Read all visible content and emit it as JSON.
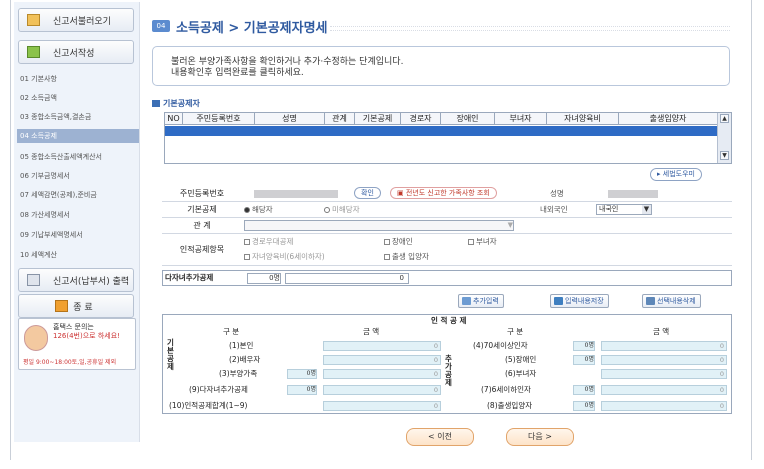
{
  "sidebar": {
    "top_buttons": [
      {
        "label": "신고서불러오기"
      },
      {
        "label": "신고서작성"
      }
    ],
    "menu": [
      {
        "label": "01 기본사항"
      },
      {
        "label": "02 소득금액"
      },
      {
        "label": "03 종합소득금액,결손금"
      },
      {
        "label": "04 소득공제",
        "active": true
      },
      {
        "label": "05 종합소득산출세액계산서"
      },
      {
        "label": "06 기부금명세서"
      },
      {
        "label": "07 세액감면(공제),준비금"
      },
      {
        "label": "08 가산세명세서"
      },
      {
        "label": "09 기납부세액명세서"
      },
      {
        "label": "10 세액계산"
      }
    ],
    "print_button": "신고서(납부서) 출력",
    "exit_button": "종 료",
    "help": {
      "line1": "홈택스 문의는",
      "line2": "126(4번)으로 하세요!",
      "hours": "평일 9:00~18:00토,일,공휴일 제외"
    }
  },
  "page": {
    "badge": "04",
    "title": "소득공제 > 기본공제자명세",
    "info_line1": "불러온 부양가족사항을 확인하거나 추가·수정하는 단계입니다.",
    "info_line2": "내용확인후 입력완료를 클릭하세요."
  },
  "grid": {
    "section_title": "기본공제자",
    "columns": [
      "NO",
      "주민등록번호",
      "성명",
      "관계",
      "기본공제",
      "경로자",
      "장애인",
      "부녀자",
      "자녀양육비",
      "출생입양자"
    ]
  },
  "help_button": "세법도우미",
  "form": {
    "rrn_label": "주민등록번호",
    "confirm_button": "확인",
    "prev_year_button": "전년도 신고한 가족사항 조회",
    "name_label": "성명",
    "basic_label": "기본공제",
    "basic_options": [
      "해당자",
      "미해당자"
    ],
    "nationality_label": "내외국인",
    "nationality_value": "내국인",
    "relation_label": "관 계",
    "personal_label": "인적공제항목",
    "checks_row1": [
      "경로우대공제",
      "장애인",
      "부녀자"
    ],
    "checks_row2": [
      "자녀양육비(6세이하자)",
      "출생 입양자"
    ],
    "multi_label": "다자녀추가공제",
    "multi_count": "0명",
    "multi_amount": "0"
  },
  "actions": {
    "add": "추가입력",
    "save": "입력내용저장",
    "delete": "선택내용삭제"
  },
  "deduct": {
    "title": "인 적 공 제",
    "col_gubun": "구 분",
    "col_amount": "금 액",
    "group_basic": "기본공제",
    "group_extra": "추가공제",
    "left_rows": [
      {
        "label": "(1)본인",
        "count": "",
        "amount": "0"
      },
      {
        "label": "(2)배우자",
        "count": "",
        "amount": "0"
      },
      {
        "label": "(3)부양가족",
        "count": "0명",
        "amount": "0"
      },
      {
        "label": "(9)다자녀추가공제",
        "count": "0명",
        "amount": "0"
      },
      {
        "label": "(10)인적공제합계(1~9)",
        "count": "",
        "amount": "0"
      }
    ],
    "right_rows": [
      {
        "label": "(4)70세이상인자",
        "count": "0명",
        "amount": "0"
      },
      {
        "label": "(5)장애인",
        "count": "0명",
        "amount": "0"
      },
      {
        "label": "(6)부녀자",
        "count": "",
        "amount": "0"
      },
      {
        "label": "(7)6세이하인자",
        "count": "0명",
        "amount": "0"
      },
      {
        "label": "(8)출생입양자",
        "count": "0명",
        "amount": "0"
      }
    ]
  },
  "nav": {
    "prev": "< 이전",
    "next": "다음 >"
  }
}
